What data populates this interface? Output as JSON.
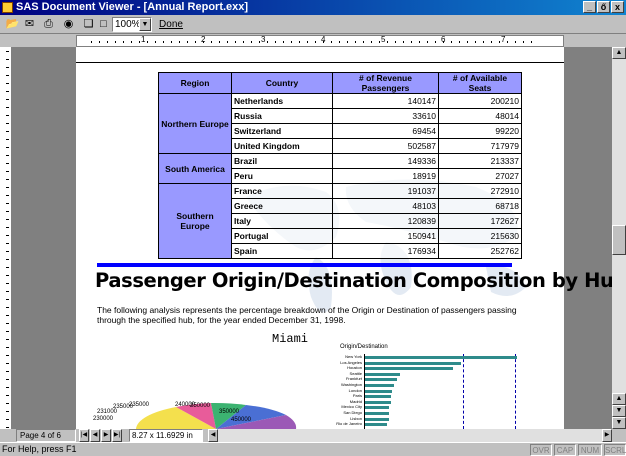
{
  "window": {
    "title": "SAS Document Viewer - [Annual Report.exx]",
    "controls": [
      "_",
      "ő",
      "x"
    ]
  },
  "toolbar": {
    "zoom": "100%",
    "done_label": "Done"
  },
  "ruler": {
    "numbers": [
      "1",
      "2",
      "3",
      "4",
      "5",
      "6",
      "7"
    ]
  },
  "table": {
    "headers": [
      "Region",
      "Country",
      "# of Revenue Passengers",
      "# of Available Seats"
    ],
    "groups": [
      {
        "region": "Northern Europe",
        "rows": [
          {
            "country": "Netherlands",
            "revenue": "140147",
            "seats": "200210"
          },
          {
            "country": "Russia",
            "revenue": "33610",
            "seats": "48014"
          },
          {
            "country": "Switzerland",
            "revenue": "69454",
            "seats": "99220"
          },
          {
            "country": "United Kingdom",
            "revenue": "502587",
            "seats": "717979"
          }
        ]
      },
      {
        "region": "South America",
        "rows": [
          {
            "country": "Brazil",
            "revenue": "149336",
            "seats": "213337"
          },
          {
            "country": "Peru",
            "revenue": "18919",
            "seats": "27027"
          }
        ]
      },
      {
        "region": "Southern Europe",
        "rows": [
          {
            "country": "France",
            "revenue": "191037",
            "seats": "272910"
          },
          {
            "country": "Greece",
            "revenue": "48103",
            "seats": "68718"
          },
          {
            "country": "Italy",
            "revenue": "120839",
            "seats": "172627"
          },
          {
            "country": "Portugal",
            "revenue": "150941",
            "seats": "215630"
          },
          {
            "country": "Spain",
            "revenue": "176934",
            "seats": "252762"
          }
        ]
      }
    ]
  },
  "report": {
    "heading": "Passenger Origin/Destination Composition by Hub",
    "paragraph": "The following analysis represents the percentage breakdown of the Origin or Destination of passengers passing through the specified hub, for the year ended December 31, 1998.",
    "hub": "Miami",
    "chart_title": "Origin/Destination"
  },
  "chart_data": {
    "type": "bar",
    "title": "Origin/Destination",
    "categories": [
      "New York",
      "Los Angeles",
      "Houston",
      "Seattle",
      "Frankfurt",
      "Washington",
      "London",
      "Paris",
      "Madrid",
      "Mexico City",
      "San Diego",
      "Lisbon",
      "Rio de Janeiro"
    ],
    "values": [
      0.95,
      0.6,
      0.55,
      0.22,
      0.2,
      0.18,
      0.17,
      0.16,
      0.16,
      0.15,
      0.15,
      0.15,
      0.14
    ],
    "pie_labels": [
      "231000",
      "230000",
      "235000",
      "235000",
      "240000",
      "250000",
      "350000",
      "450000"
    ]
  },
  "nav": {
    "page_label": "Page 4 of 6",
    "size": "8.27 x 11.6929 in"
  },
  "status": {
    "text": "For Help, press F1",
    "indicators": [
      "OVR",
      "CAP",
      "NUM",
      "SCRL"
    ]
  }
}
